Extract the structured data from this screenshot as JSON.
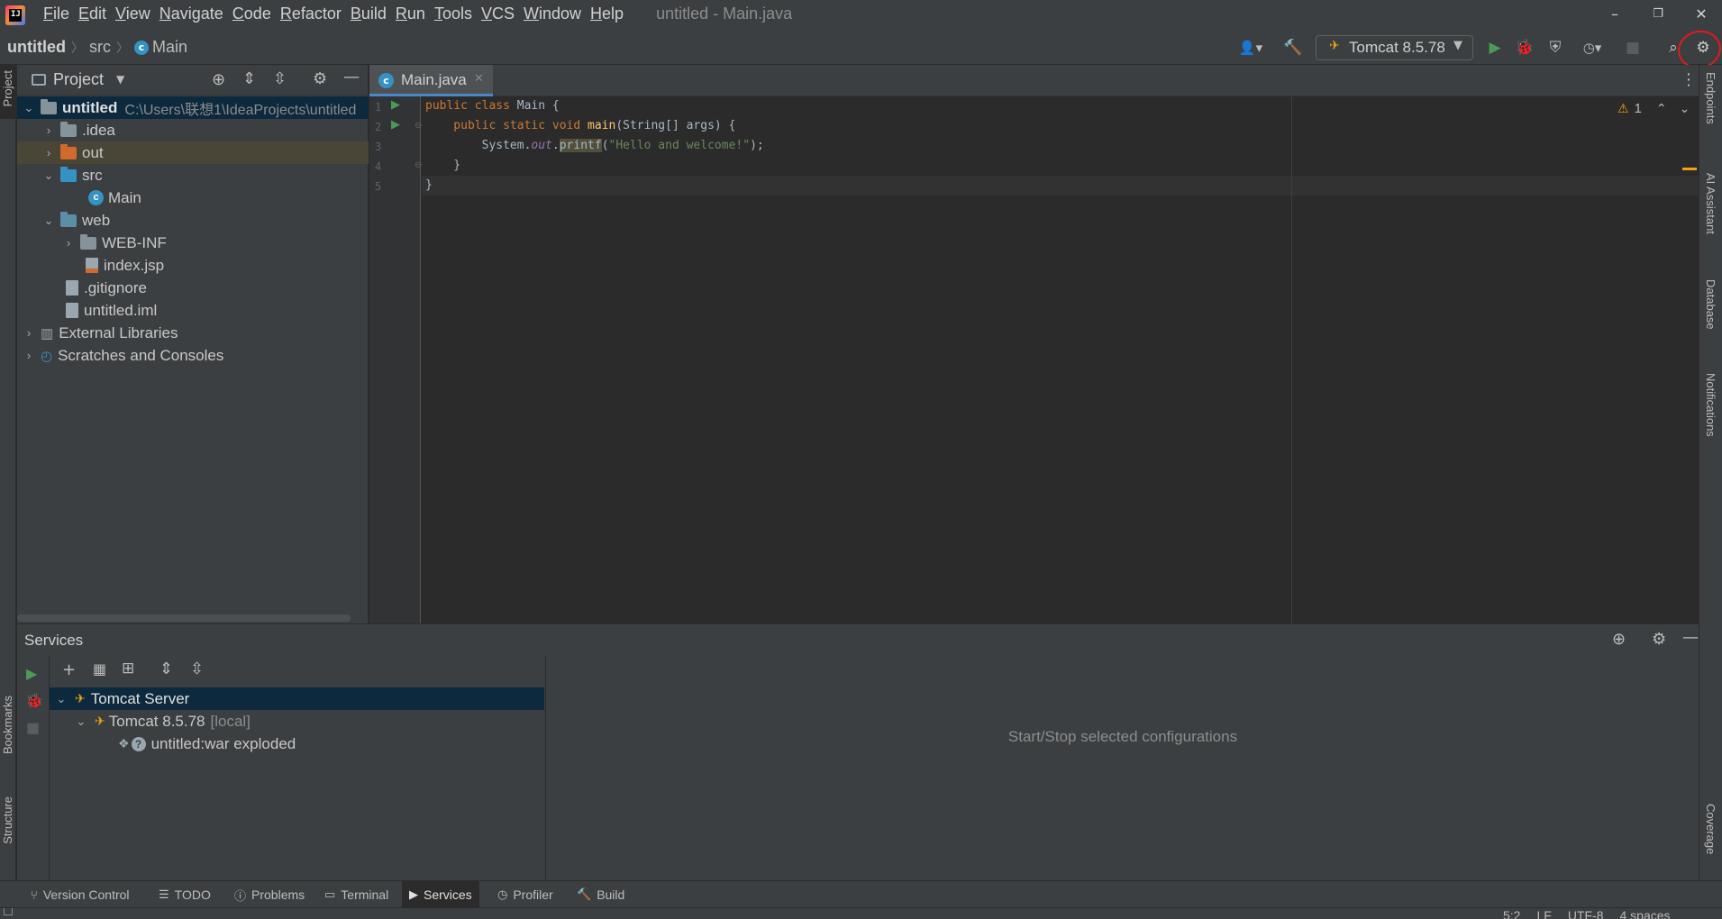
{
  "titlebar": {
    "menu": [
      "File",
      "Edit",
      "View",
      "Navigate",
      "Code",
      "Refactor",
      "Build",
      "Run",
      "Tools",
      "VCS",
      "Window",
      "Help"
    ],
    "title": "untitled - Main.java",
    "minimize": "–",
    "restore": "❐",
    "close": "✕"
  },
  "navbar": {
    "breadcrumb": [
      "untitled",
      "src",
      "Main"
    ],
    "run_config": "Tomcat 8.5.78"
  },
  "project": {
    "header": "Project",
    "tree": [
      {
        "label": "untitled",
        "path": "C:\\Users\\联想1\\IdeaProjects\\untitled"
      },
      {
        "label": ".idea"
      },
      {
        "label": "out"
      },
      {
        "label": "src"
      },
      {
        "label": "Main"
      },
      {
        "label": "web"
      },
      {
        "label": "WEB-INF"
      },
      {
        "label": "index.jsp"
      },
      {
        "label": ".gitignore"
      },
      {
        "label": "untitled.iml"
      },
      {
        "label": "External Libraries"
      },
      {
        "label": "Scratches and Consoles"
      }
    ]
  },
  "editor": {
    "tab": "Main.java",
    "line_numbers": [
      "1",
      "2",
      "3",
      "4",
      "5"
    ],
    "warnings": "1",
    "code": {
      "l1_kw": "public class ",
      "l1_name": "Main {",
      "l2_kw": "    public static void ",
      "l2_fn": "main",
      "l2_rest": "(String[] args) {",
      "l3_a": "        System.",
      "l3_fld": "out",
      "l3_b": ".",
      "l3_fn": "printf",
      "l3_c": "(",
      "l3_str": "\"Hello and welcome!\"",
      "l3_d": ");",
      "l4": "    }",
      "l5": "}"
    }
  },
  "services": {
    "title": "Services",
    "tree": [
      {
        "label": "Tomcat Server"
      },
      {
        "label": "Tomcat 8.5.78",
        "suffix": "[local]"
      },
      {
        "label": "untitled:war exploded"
      }
    ],
    "empty_text": "Start/Stop selected configurations"
  },
  "left_strip": {
    "project": "Project",
    "bookmarks": "Bookmarks",
    "structure": "Structure"
  },
  "right_strip": {
    "endpoints": "Endpoints",
    "ai_assistant": "AI Assistant",
    "database": "Database",
    "notifications": "Notifications",
    "coverage": "Coverage"
  },
  "bottombar": {
    "tabs": [
      "Version Control",
      "TODO",
      "Problems",
      "Terminal",
      "Services",
      "Profiler",
      "Build"
    ]
  },
  "status": {
    "position": "5:2",
    "line_sep": "LF",
    "encoding": "UTF-8",
    "indent": "4 spaces"
  },
  "colors": {
    "accent": "#3592c4",
    "selection": "#0d293e",
    "annotation": "#e01b1b",
    "run_green": "#499c54"
  }
}
